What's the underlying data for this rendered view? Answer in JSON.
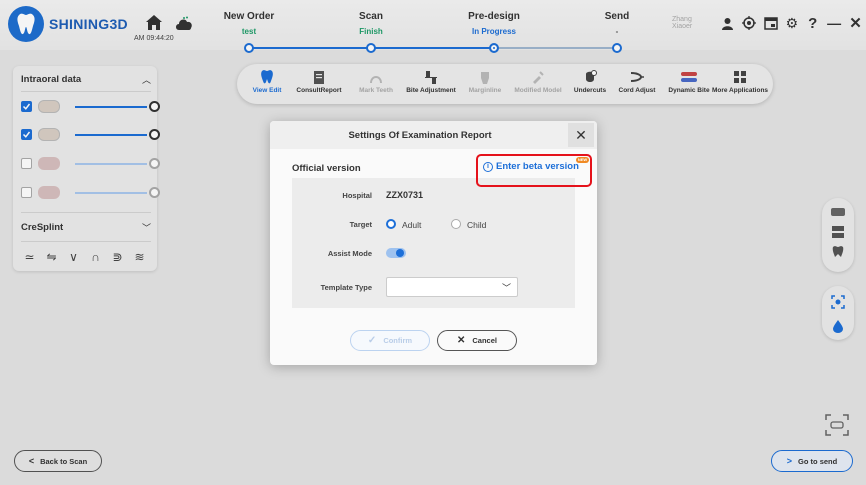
{
  "app": {
    "logo_text": "SHINING3D",
    "clock": "AM 09:44:20",
    "user_name": "Zhang Xiaoer"
  },
  "steps": [
    {
      "name": "New Order",
      "status": "test",
      "status_color": "#1f9e6a",
      "state": "done"
    },
    {
      "name": "Scan",
      "status": "Finish",
      "status_color": "#1f9e6a",
      "state": "done"
    },
    {
      "name": "Pre-design",
      "status": "In Progress",
      "status_color": "#1d6fd8",
      "state": "current"
    },
    {
      "name": "Send",
      "status": "-",
      "status_color": "#555555",
      "state": "todo"
    }
  ],
  "left_panel": {
    "intraoral_title": "Intraoral data",
    "splint_title": "CreSplint",
    "layers": [
      {
        "checked": true,
        "slider": 1.0
      },
      {
        "checked": true,
        "slider": 1.0
      },
      {
        "checked": false,
        "slider": 1.0
      },
      {
        "checked": false,
        "slider": 1.0
      }
    ]
  },
  "toolbar": {
    "tools": [
      {
        "label": "View Edit",
        "icon": "view-edit-icon",
        "state": "active"
      },
      {
        "label": "ConsultReport",
        "icon": "consult-report-icon",
        "state": "normal"
      },
      {
        "label": "Mark Teeth",
        "icon": "mark-teeth-icon",
        "state": "disabled"
      },
      {
        "label": "Bite Adjustment",
        "icon": "bite-adjustment-icon",
        "state": "normal"
      },
      {
        "label": "Marginline",
        "icon": "marginline-icon",
        "state": "disabled"
      },
      {
        "label": "Modified Model",
        "icon": "modified-model-icon",
        "state": "disabled"
      },
      {
        "label": "Undercuts",
        "icon": "undercuts-icon",
        "state": "normal"
      },
      {
        "label": "Cord Adjust",
        "icon": "cord-adjust-icon",
        "state": "normal"
      },
      {
        "label": "Dynamic Bite",
        "icon": "dynamic-bite-icon",
        "state": "normal"
      },
      {
        "label": "More Applications",
        "icon": "more-applications-icon",
        "state": "normal"
      }
    ]
  },
  "dialog": {
    "title": "Settings Of Examination Report",
    "close": "✕",
    "version_label": "Official version",
    "beta_link": "Enter beta version",
    "beta_badge": "NEW",
    "hospital_label": "Hospital",
    "hospital_value": "ZZX0731",
    "target_label": "Target",
    "target_options": [
      "Adult",
      "Child"
    ],
    "target_selected": "Adult",
    "assist_label": "Assist Mode",
    "assist_on": true,
    "template_label": "Template Type",
    "template_value": "",
    "confirm_label": "Confirm",
    "cancel_label": "Cancel"
  },
  "footer": {
    "back_label": "Back to Scan",
    "next_label": "Go to send"
  },
  "colors": {
    "accent": "#1d6fd8",
    "highlight": "#e5121b",
    "success": "#1f9e6a"
  }
}
